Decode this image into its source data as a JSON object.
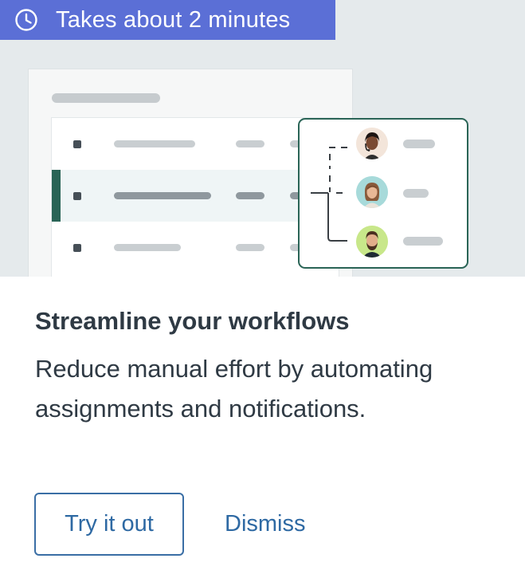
{
  "badge": {
    "icon": "clock-icon",
    "text": "Takes about 2 minutes",
    "color": "#5b6fd6"
  },
  "illustration": {
    "accent_color": "#2a6456",
    "avatars": [
      "woman-headset-avatar",
      "woman-avatar",
      "bearded-man-avatar"
    ]
  },
  "content": {
    "title": "Streamline your workflows",
    "description": "Reduce manual effort by automating assignments and notifications."
  },
  "actions": {
    "primary_label": "Try it out",
    "secondary_label": "Dismiss",
    "link_color": "#2e69a3"
  }
}
